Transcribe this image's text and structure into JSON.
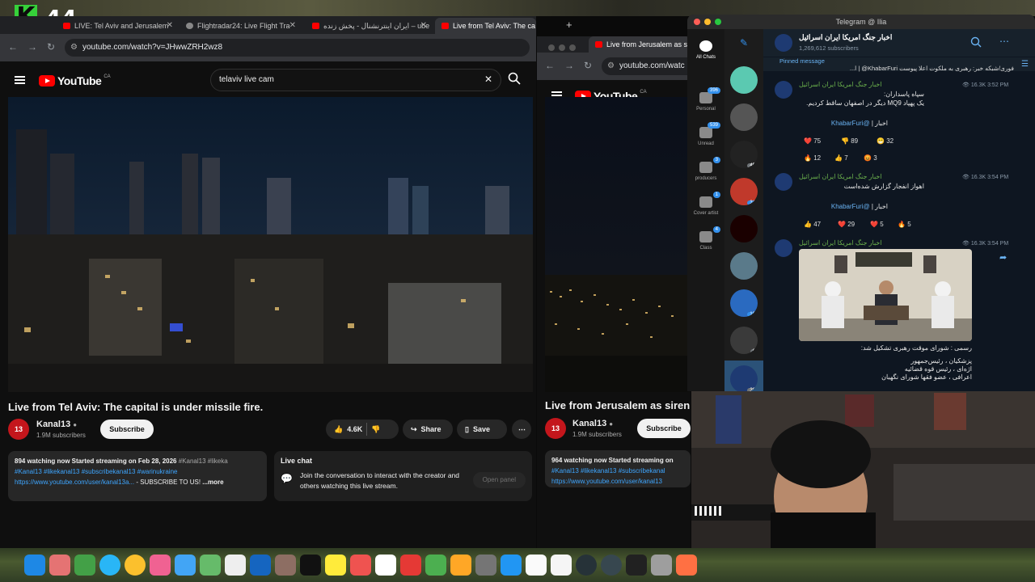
{
  "overlay": {
    "logo_letter": "K",
    "counter": "44"
  },
  "left_browser": {
    "tabs": [
      {
        "title": "LIVE: Tel Aviv and Jerusalem"
      },
      {
        "title": "Flightradar24: Live Flight Tra"
      },
      {
        "title": "ایران اینترنشنال - پخش زنده – ube"
      },
      {
        "title": "Live from Tel Aviv: The ca"
      }
    ],
    "url": "youtube.com/watch?v=JHwwZRH2wz8",
    "youtube": {
      "brand": "YouTube",
      "region": "CA",
      "search_value": "telaviv live cam",
      "video_title": "Live from Tel Aviv: The capital is under missile fire.",
      "channel": {
        "avatar_text": "13",
        "name": "Kanal13",
        "subscribers": "1.9M subscribers"
      },
      "subscribe_label": "Subscribe",
      "like_count": "4.6K",
      "share_label": "Share",
      "save_label": "Save",
      "description": {
        "line1_bold": "894 watching now  Started streaming on Feb 28, 2026",
        "line1_tags": "#Kanal13 #likeka",
        "line2_tags": "#Kanal13 #likekanal13 #subscribekanal13 #warinukraine",
        "line3_link": "https://www.youtube.com/user/kanal13a...",
        "line3_rest": "- SUBSCRIBE TO US!",
        "more": "...more"
      },
      "live_chat": {
        "title": "Live chat",
        "message": "Join the conversation to interact with the creator and others watching this live stream.",
        "button": "Open panel"
      }
    }
  },
  "right_browser": {
    "tab_title": "Live from Jerusalem as si",
    "url": "youtube.com/watc",
    "youtube": {
      "brand": "YouTube",
      "region": "CA",
      "video_title": "Live from Jerusalem as siren",
      "channel": {
        "avatar_text": "13",
        "name": "Kanal13",
        "subscribers": "1.9M subscribers"
      },
      "subscribe_label": "Subscribe",
      "description": {
        "line1_bold": "964 watching now  Started streaming on",
        "line2_tags": "#Kanal13 #likekanal13 #subscribekanal",
        "line3_link": "https://www.youtube.com/user/kanal13"
      }
    }
  },
  "telegram": {
    "window_title": "Telegram @ Ilia",
    "folders": [
      {
        "label": "All Chats",
        "badge": ""
      },
      {
        "label": "Personal",
        "badge": "396"
      },
      {
        "label": "Unread",
        "badge": "539"
      },
      {
        "label": "producers",
        "badge": "3"
      },
      {
        "label": "Cover artist",
        "badge": "1"
      },
      {
        "label": "Class",
        "badge": "4"
      }
    ],
    "chat_list_badges": [
      "",
      "",
      "45",
      "34",
      "",
      "",
      "10",
      "6",
      "36"
    ],
    "channel": {
      "name": "اخبار جنگ امریکا ایران اسرائیل",
      "subscribers": "1,269,612 subscribers"
    },
    "pinned": {
      "label": "Pinned message",
      "text": "فوری/شبکه خبر: رهبری به ملکوت اعلا پیوست KhabarFuri@ | ا..."
    },
    "messages": [
      {
        "sender": "اخبار جنگ امریکا ایران اسرائیل",
        "views_time": "16.3K  3:52 PM",
        "lines": [
          "سپاه پاسداران:",
          "یک پهپاد MQ9 دیگر در اصفهان ساقط کردیم."
        ],
        "footer_label": "اخبار |",
        "footer_link": "@KhabarFuri",
        "reactions": [
          {
            "emoji": "❤️",
            "count": "75"
          },
          {
            "emoji": "👎",
            "count": "89"
          },
          {
            "emoji": "😁",
            "count": "32"
          },
          {
            "emoji": "🔥",
            "count": "12"
          },
          {
            "emoji": "👍",
            "count": "7"
          },
          {
            "emoji": "😡",
            "count": "3"
          }
        ]
      },
      {
        "sender": "اخبار جنگ امریکا ایران اسرائیل",
        "views_time": "16.3K  3:54 PM",
        "lines": [
          "اهواز انفجار گزارش شده‌است"
        ],
        "footer_label": "اخبار |",
        "footer_link": "@KhabarFuri",
        "reactions": [
          {
            "emoji": "👍",
            "count": "47"
          },
          {
            "emoji": "❤️",
            "count": "29"
          },
          {
            "emoji": "❤️",
            "count": "5"
          },
          {
            "emoji": "🔥",
            "count": "5"
          }
        ]
      },
      {
        "sender": "اخبار جنگ امریکا ایران اسرائیل",
        "views_time": "16.3K  3:54 PM",
        "lines": [
          "رسمی : شورای موقت رهبری تشکیل شد:",
          "پزشکیان ، رئیس‌جمهور",
          "اژه‌ای ، رئیس قوه قضائیه",
          "اعرافی ، عضو فقها شورای نگهبان"
        ]
      }
    ]
  },
  "colors": {
    "youtube_red": "#ff0000",
    "telegram_blue": "#3390ec",
    "channel_green": "#6ab04c"
  }
}
